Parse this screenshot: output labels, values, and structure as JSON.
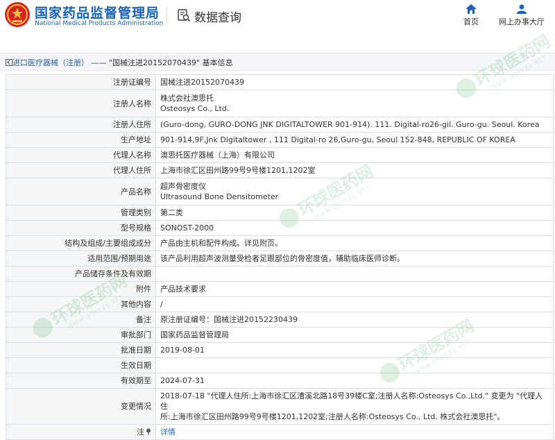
{
  "header": {
    "org_name_cn": "国家药品监督管理局",
    "org_name_en": "National Medical Products Administration",
    "section_title": "数据查询",
    "nav": [
      {
        "label": "首页",
        "icon": "home-icon"
      },
      {
        "label": "网上办事大厅",
        "icon": "user-icon"
      }
    ]
  },
  "breadcrumb": {
    "back_label": "进口医疗器械（注册）",
    "separator": "——",
    "current": "\"国械注进20152070439\" 基本信息"
  },
  "record": {
    "rows": [
      {
        "label": "注册证编号",
        "value": "国械注进20152070439"
      },
      {
        "label": "注册人名称",
        "value": "株式会社澳思托",
        "value2": "Osteosys Co., Ltd."
      },
      {
        "label": "注册人住所",
        "value": "(Guro-dong, GURO-DONG JNK DIGITALTOWER 901-914). 111. Digital-ro26-gil. Guro-gu. Seoul. Korea"
      },
      {
        "label": "生产地址",
        "value": "901-914,9F,Jnk Digitaltower , 111 Digital-ro 26,Guro-gu, Seoul 152-848, REPUBLIC OF KOREA"
      },
      {
        "label": "代理人名称",
        "value": "澳思托医疗器械（上海）有限公司"
      },
      {
        "label": "代理人住所",
        "value": "上海市徐汇区田州路99号9号楼1201,1202室"
      },
      {
        "label": "产品名称",
        "value": "超声骨密度仪",
        "value2": "Ultrasound Bone Densitometer"
      },
      {
        "label": "管理类别",
        "value": "第二类"
      },
      {
        "label": "型号规格",
        "value": "SONOST-2000"
      },
      {
        "label": "结构及组成/主要组成成分",
        "value": "产品由主机和配件构成。详见附页。"
      },
      {
        "label": "适用范围/预期用途",
        "value": "该产品利用超声波测量受检者足跟部位的骨密度值，辅助临床医师诊断。"
      },
      {
        "label": "产品储存条件及有效期",
        "value": ""
      },
      {
        "label": "附件",
        "value": "产品技术要求"
      },
      {
        "label": "其他内容",
        "value": "/"
      },
      {
        "label": "备注",
        "value": "原注册证编号：国械注进20152230439"
      },
      {
        "label": "审批部门",
        "value": "国家药品监督管理局"
      },
      {
        "label": "批准日期",
        "value": "2019-08-01"
      },
      {
        "label": "生效日期",
        "value": ""
      },
      {
        "label": "有效期至",
        "value": "2024-07-31"
      },
      {
        "label": "变更情况",
        "value": "2018-07-18 \"代理人住所:上海市徐汇区漕溪北路18号39楼C室;注册人名称:Osteosys Co.,Ltd.\" 变更为 \"代理人住",
        "value2": "所:上海市徐汇区田州路99号9号楼1201,1202室;注册人名称:Osteosys Co., Ltd. 株式会社澳思托\"。"
      }
    ],
    "last_row": {
      "label": "注",
      "link": "详情"
    }
  },
  "watermark": {
    "text": "环球医药网",
    "sub": "WWW.QGYYZS.NET"
  },
  "colors": {
    "brand": "#1a63b8",
    "link": "#2b6cb8",
    "label_bg": "#f5f6f8",
    "border": "#dcdfe5"
  }
}
